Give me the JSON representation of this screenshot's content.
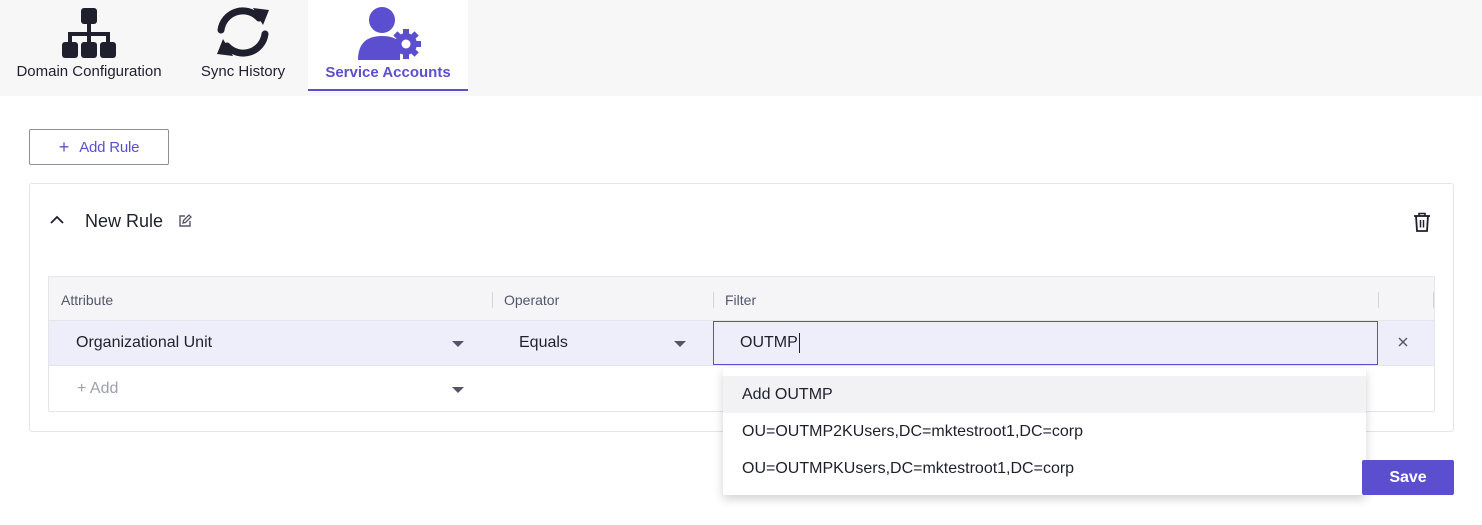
{
  "tabs": [
    {
      "label": "Domain Configuration",
      "icon": "sitemap-icon",
      "active": false
    },
    {
      "label": "Sync History",
      "icon": "sync-icon",
      "active": false
    },
    {
      "label": "Service Accounts",
      "icon": "user-gear-icon",
      "active": true
    }
  ],
  "toolbar": {
    "add_rule_plus": "+",
    "add_rule_label": "Add Rule"
  },
  "rule": {
    "title": "New Rule",
    "columns": {
      "attribute": "Attribute",
      "operator": "Operator",
      "filter": "Filter"
    },
    "row": {
      "attribute": "Organizational Unit",
      "operator": "Equals",
      "filter_value": "OUTMP"
    },
    "add_placeholder": "+ Add"
  },
  "dropdown": {
    "options": [
      "Add OUTMP",
      "OU=OUTMP2KUsers,DC=mktestroot1,DC=corp",
      "OU=OUTMPKUsers,DC=mktestroot1,DC=corp"
    ]
  },
  "actions": {
    "save_label": "Save"
  },
  "colors": {
    "accent": "#5b4fcf",
    "icon_dark": "#1f1f2e"
  }
}
